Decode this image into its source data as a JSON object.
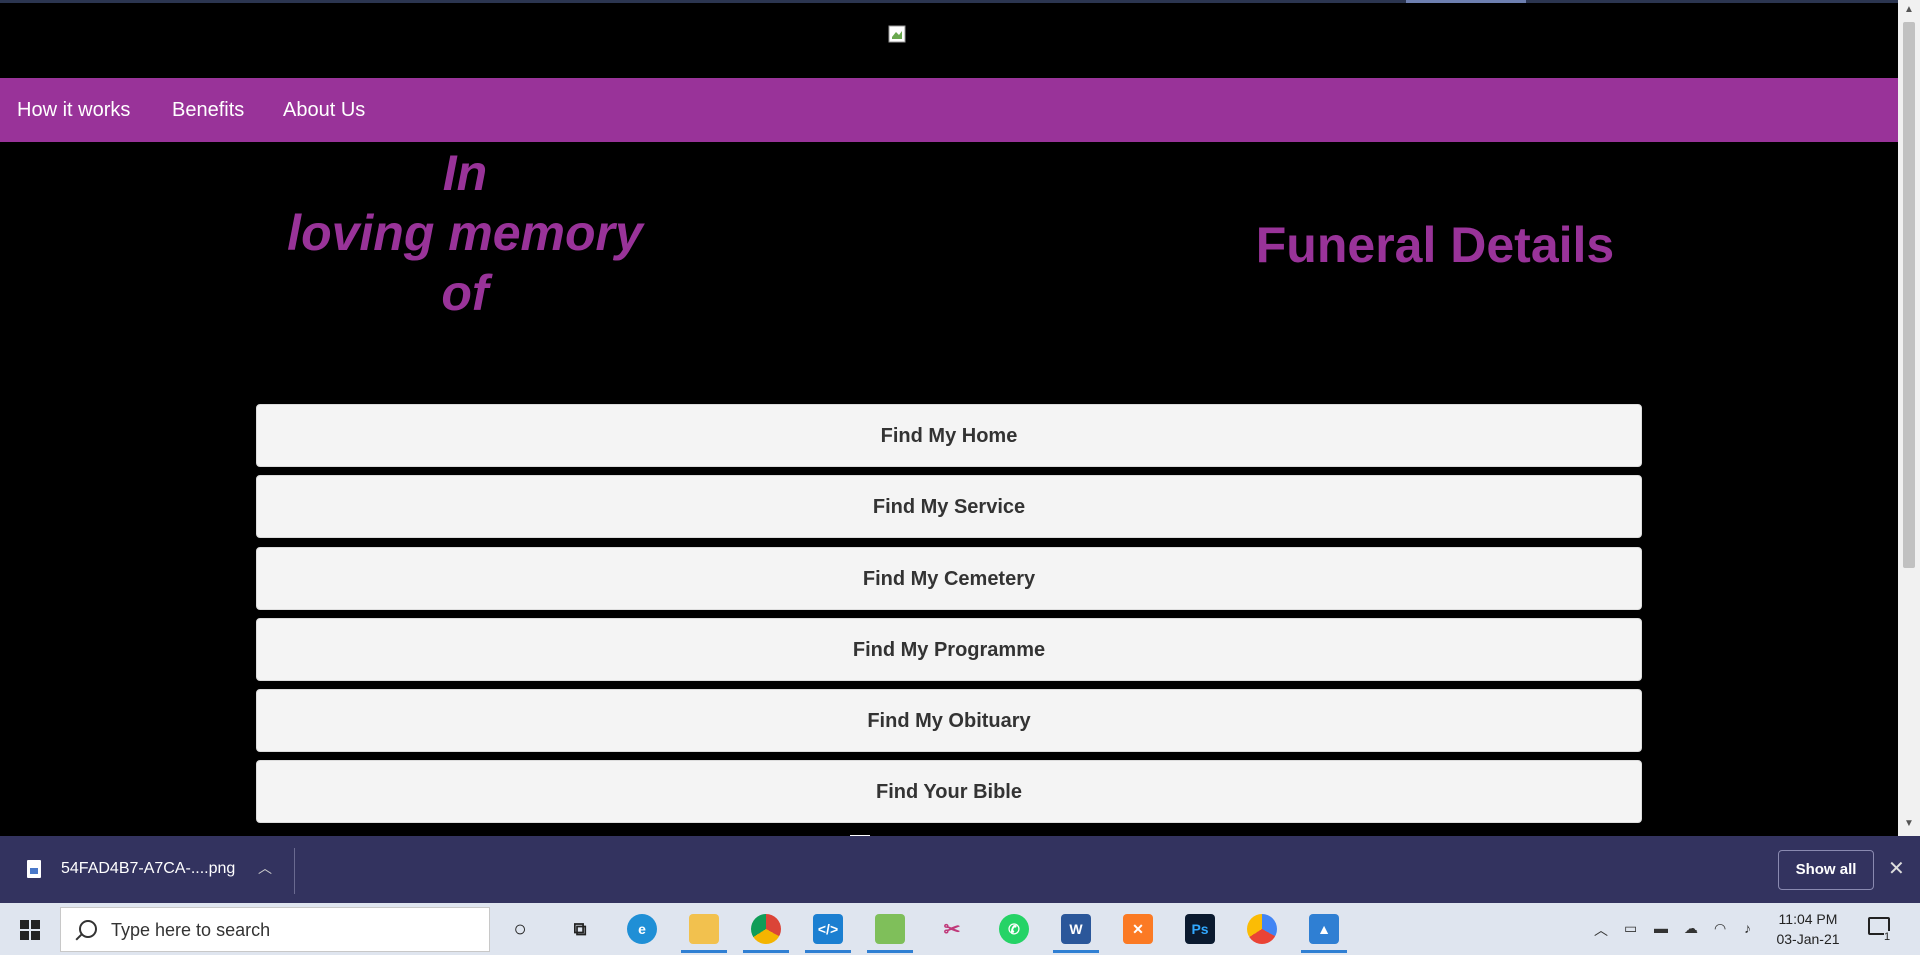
{
  "site": {
    "nav": [
      "How it works",
      "Benefits",
      "About Us"
    ],
    "memory_heading": [
      "In",
      "loving memory",
      "of"
    ],
    "funeral_heading": "Funeral Details",
    "buttons": [
      "Find My Home",
      "Find My Service",
      "Find My Cemetery",
      "Find My Programme",
      "Find My Obituary",
      "Find Your Bible"
    ],
    "brand_color": "#993399"
  },
  "download_bar": {
    "filename": "54FAD4B7-A7CA-....png",
    "show_all": "Show all"
  },
  "taskbar": {
    "search_placeholder": "Type here to search",
    "apps": [
      "cortana-icon",
      "task-view-icon",
      "edge-icon",
      "file-explorer-icon",
      "chrome-icon",
      "vscode-icon",
      "paint-icon",
      "snip-icon",
      "whatsapp-icon",
      "word-icon",
      "xampp-icon",
      "photoshop-icon",
      "google-drive-icon",
      "photos-icon"
    ],
    "time": "11:04 PM",
    "date": "03-Jan-21",
    "notification_count": "1"
  }
}
